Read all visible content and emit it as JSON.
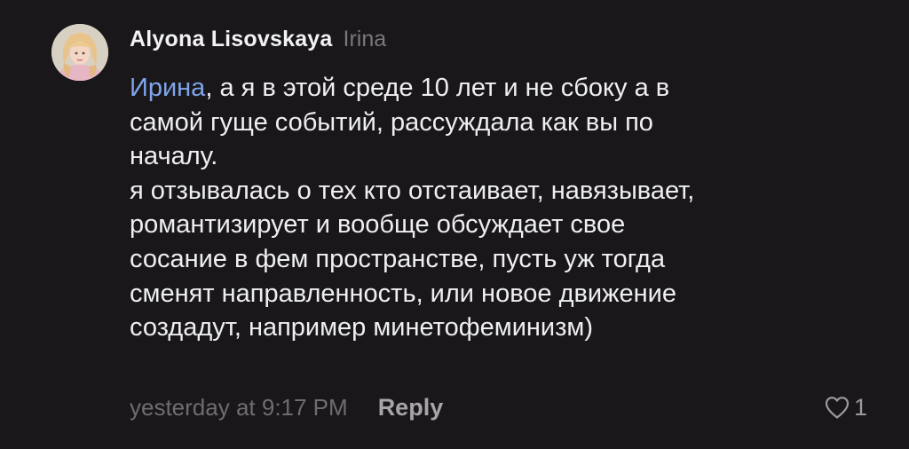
{
  "comment": {
    "author": "Alyona Lisovskaya",
    "reply_to": "Irina",
    "mention": "Ирина",
    "body_lines": [
      ", а я в этой среде 10 лет и не сбоку а в",
      "самой гуще событий, рассуждала как вы по",
      "началу.",
      "я отзывалась о тех кто отстаивает, навязывает,",
      "романтизирует и вообще обсуждает свое",
      "сосание в фем пространстве, пусть уж тогда",
      "сменят направленность, или новое движение",
      "создадут, например минетофеминизм)"
    ],
    "timestamp": "yesterday at 9:17 PM",
    "reply_label": "Reply",
    "like_count": "1",
    "avatar_icon": "user-avatar-photo",
    "like_icon": "heart-outline-icon"
  },
  "colors": {
    "background": "#19171a",
    "text": "#efeef0",
    "mention": "#7fa4ea",
    "muted": "#6f6c72"
  }
}
